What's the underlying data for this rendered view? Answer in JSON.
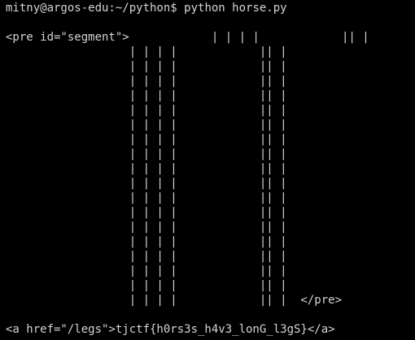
{
  "terminal": {
    "background": "#000000",
    "foreground": "#d4d4d4",
    "prompt": "mitny@argos-edu:~/python$ ",
    "command": "python horse.py",
    "output_lines": [
      "<pre id=\"segment\">            | | | |            || |",
      "                  | | | |            || |",
      "                  | | | |            || |",
      "                  | | | |            || |",
      "                  | | | |            || |",
      "                  | | | |            || |",
      "                  | | | |            || |",
      "                  | | | |            || |",
      "                  | | | |            || |",
      "                  | | | |            || |",
      "                  | | | |            || |",
      "                  | | | |            || |",
      "                  | | | |            || |",
      "                  | | | |            || |",
      "                  | | | |            || |",
      "                  | | | |            || |",
      "                  | | | |            || |",
      "                  | | | |            || |",
      "                  | | | |            || |  </pre>",
      "",
      "<a href=\"/legs\">tjctf{h0rs3s_h4v3_lonG_l3gS}</a>"
    ]
  }
}
